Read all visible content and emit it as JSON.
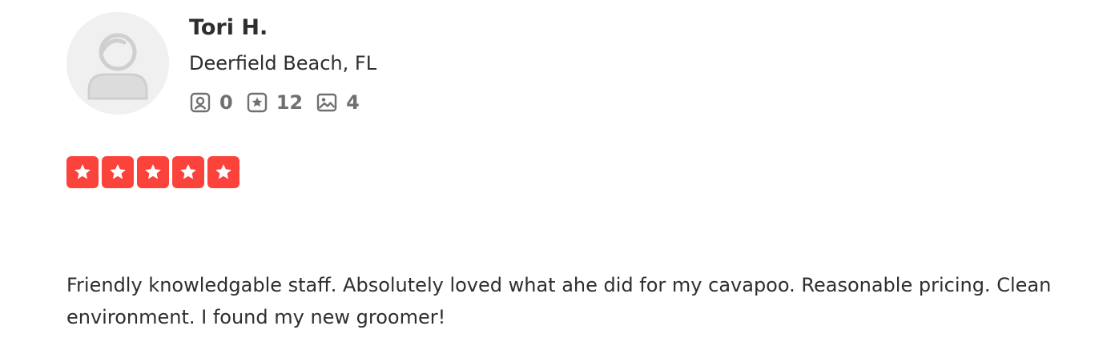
{
  "user": {
    "name": "Tori H.",
    "location": "Deerfield Beach, FL"
  },
  "stats": {
    "friends": "0",
    "reviews": "12",
    "photos": "4"
  },
  "rating": {
    "stars": 5,
    "max": 5,
    "color": "#fb433c"
  },
  "review": {
    "text": "Friendly knowledgable staff. Absolutely loved what ahe did for my cavapoo. Reasonable pricing. Clean environment. I found my new groomer!"
  }
}
